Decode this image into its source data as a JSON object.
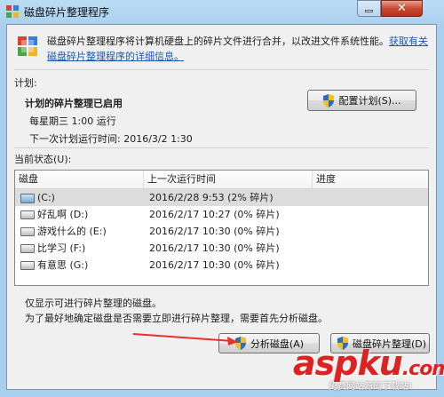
{
  "window": {
    "title": "磁盘碎片整理程序",
    "close_glyph": "✕"
  },
  "intro": {
    "text": "磁盘碎片整理程序将计算机硬盘上的碎片文件进行合并，以改进文件系统性能。",
    "link": "获取有关磁盘碎片整理程序的详细信息。"
  },
  "schedule": {
    "section_label": "计划:",
    "status": "计划的碎片整理已启用",
    "when": "每星期三  1:00 运行",
    "next_run": "下一次计划运行时间: 2016/3/2 1:30",
    "configure_button": "配置计划(S)..."
  },
  "current_status": {
    "label": "当前状态(U):",
    "columns": [
      "磁盘",
      "上一次运行时间",
      "进度"
    ],
    "rows": [
      {
        "disk": "(C:)",
        "last_run": "2016/2/28 9:53 (2% 碎片)",
        "progress": "",
        "icon": "system-drive-icon"
      },
      {
        "disk": "好乱啊 (D:)",
        "last_run": "2016/2/17 10:27 (0% 碎片)",
        "progress": "",
        "icon": "drive-icon"
      },
      {
        "disk": "游戏什么的 (E:)",
        "last_run": "2016/2/17 10:30 (0% 碎片)",
        "progress": "",
        "icon": "drive-icon"
      },
      {
        "disk": "比学习 (F:)",
        "last_run": "2016/2/17 10:30 (0% 碎片)",
        "progress": "",
        "icon": "drive-icon"
      },
      {
        "disk": "有意思 (G:)",
        "last_run": "2016/2/17 10:30 (0% 碎片)",
        "progress": "",
        "icon": "drive-icon"
      }
    ]
  },
  "notes": {
    "line1": "仅显示可进行碎片整理的磁盘。",
    "line2": "为了最好地确定磁盘是否需要立即进行碎片整理，需要首先分析磁盘。"
  },
  "buttons": {
    "analyze": "分析磁盘(A)",
    "defrag": "磁盘碎片整理(D)"
  },
  "watermark": {
    "main": "aspku",
    "tld": ".com",
    "sub": "免费网站源码下载站!"
  },
  "colors": {
    "accent_red": "#dd2222",
    "link_blue": "#1b59b0",
    "title_blue": "#a9cfee"
  }
}
